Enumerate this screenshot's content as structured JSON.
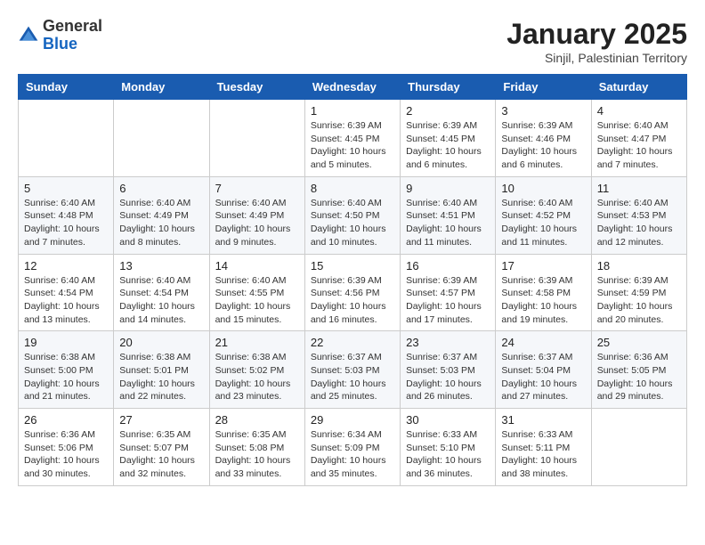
{
  "header": {
    "logo_general": "General",
    "logo_blue": "Blue",
    "title": "January 2025",
    "subtitle": "Sinjil, Palestinian Territory"
  },
  "calendar": {
    "days_of_week": [
      "Sunday",
      "Monday",
      "Tuesday",
      "Wednesday",
      "Thursday",
      "Friday",
      "Saturday"
    ],
    "weeks": [
      {
        "cells": [
          {
            "day": "",
            "info": ""
          },
          {
            "day": "",
            "info": ""
          },
          {
            "day": "",
            "info": ""
          },
          {
            "day": "1",
            "info": "Sunrise: 6:39 AM\nSunset: 4:45 PM\nDaylight: 10 hours\nand 5 minutes."
          },
          {
            "day": "2",
            "info": "Sunrise: 6:39 AM\nSunset: 4:45 PM\nDaylight: 10 hours\nand 6 minutes."
          },
          {
            "day": "3",
            "info": "Sunrise: 6:39 AM\nSunset: 4:46 PM\nDaylight: 10 hours\nand 6 minutes."
          },
          {
            "day": "4",
            "info": "Sunrise: 6:40 AM\nSunset: 4:47 PM\nDaylight: 10 hours\nand 7 minutes."
          }
        ]
      },
      {
        "cells": [
          {
            "day": "5",
            "info": "Sunrise: 6:40 AM\nSunset: 4:48 PM\nDaylight: 10 hours\nand 7 minutes."
          },
          {
            "day": "6",
            "info": "Sunrise: 6:40 AM\nSunset: 4:49 PM\nDaylight: 10 hours\nand 8 minutes."
          },
          {
            "day": "7",
            "info": "Sunrise: 6:40 AM\nSunset: 4:49 PM\nDaylight: 10 hours\nand 9 minutes."
          },
          {
            "day": "8",
            "info": "Sunrise: 6:40 AM\nSunset: 4:50 PM\nDaylight: 10 hours\nand 10 minutes."
          },
          {
            "day": "9",
            "info": "Sunrise: 6:40 AM\nSunset: 4:51 PM\nDaylight: 10 hours\nand 11 minutes."
          },
          {
            "day": "10",
            "info": "Sunrise: 6:40 AM\nSunset: 4:52 PM\nDaylight: 10 hours\nand 11 minutes."
          },
          {
            "day": "11",
            "info": "Sunrise: 6:40 AM\nSunset: 4:53 PM\nDaylight: 10 hours\nand 12 minutes."
          }
        ]
      },
      {
        "cells": [
          {
            "day": "12",
            "info": "Sunrise: 6:40 AM\nSunset: 4:54 PM\nDaylight: 10 hours\nand 13 minutes."
          },
          {
            "day": "13",
            "info": "Sunrise: 6:40 AM\nSunset: 4:54 PM\nDaylight: 10 hours\nand 14 minutes."
          },
          {
            "day": "14",
            "info": "Sunrise: 6:40 AM\nSunset: 4:55 PM\nDaylight: 10 hours\nand 15 minutes."
          },
          {
            "day": "15",
            "info": "Sunrise: 6:39 AM\nSunset: 4:56 PM\nDaylight: 10 hours\nand 16 minutes."
          },
          {
            "day": "16",
            "info": "Sunrise: 6:39 AM\nSunset: 4:57 PM\nDaylight: 10 hours\nand 17 minutes."
          },
          {
            "day": "17",
            "info": "Sunrise: 6:39 AM\nSunset: 4:58 PM\nDaylight: 10 hours\nand 19 minutes."
          },
          {
            "day": "18",
            "info": "Sunrise: 6:39 AM\nSunset: 4:59 PM\nDaylight: 10 hours\nand 20 minutes."
          }
        ]
      },
      {
        "cells": [
          {
            "day": "19",
            "info": "Sunrise: 6:38 AM\nSunset: 5:00 PM\nDaylight: 10 hours\nand 21 minutes."
          },
          {
            "day": "20",
            "info": "Sunrise: 6:38 AM\nSunset: 5:01 PM\nDaylight: 10 hours\nand 22 minutes."
          },
          {
            "day": "21",
            "info": "Sunrise: 6:38 AM\nSunset: 5:02 PM\nDaylight: 10 hours\nand 23 minutes."
          },
          {
            "day": "22",
            "info": "Sunrise: 6:37 AM\nSunset: 5:03 PM\nDaylight: 10 hours\nand 25 minutes."
          },
          {
            "day": "23",
            "info": "Sunrise: 6:37 AM\nSunset: 5:03 PM\nDaylight: 10 hours\nand 26 minutes."
          },
          {
            "day": "24",
            "info": "Sunrise: 6:37 AM\nSunset: 5:04 PM\nDaylight: 10 hours\nand 27 minutes."
          },
          {
            "day": "25",
            "info": "Sunrise: 6:36 AM\nSunset: 5:05 PM\nDaylight: 10 hours\nand 29 minutes."
          }
        ]
      },
      {
        "cells": [
          {
            "day": "26",
            "info": "Sunrise: 6:36 AM\nSunset: 5:06 PM\nDaylight: 10 hours\nand 30 minutes."
          },
          {
            "day": "27",
            "info": "Sunrise: 6:35 AM\nSunset: 5:07 PM\nDaylight: 10 hours\nand 32 minutes."
          },
          {
            "day": "28",
            "info": "Sunrise: 6:35 AM\nSunset: 5:08 PM\nDaylight: 10 hours\nand 33 minutes."
          },
          {
            "day": "29",
            "info": "Sunrise: 6:34 AM\nSunset: 5:09 PM\nDaylight: 10 hours\nand 35 minutes."
          },
          {
            "day": "30",
            "info": "Sunrise: 6:33 AM\nSunset: 5:10 PM\nDaylight: 10 hours\nand 36 minutes."
          },
          {
            "day": "31",
            "info": "Sunrise: 6:33 AM\nSunset: 5:11 PM\nDaylight: 10 hours\nand 38 minutes."
          },
          {
            "day": "",
            "info": ""
          }
        ]
      }
    ]
  }
}
